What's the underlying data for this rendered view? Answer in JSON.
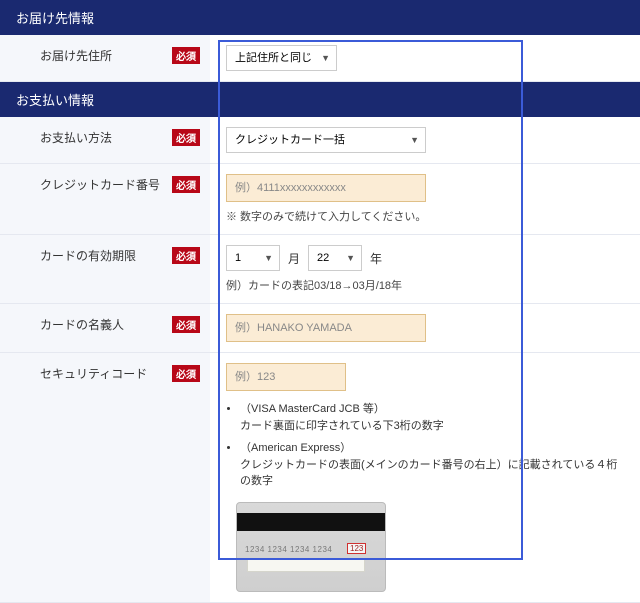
{
  "delivery": {
    "header": "お届け先情報",
    "address_label": "お届け先住所",
    "required": "必須",
    "address_select": "上記住所と同じ"
  },
  "payment": {
    "header": "お支払い情報",
    "method_label": "お支払い方法",
    "method_select": "クレジットカード一括",
    "cc_number_label": "クレジットカード番号",
    "cc_number_placeholder": "例）4111xxxxxxxxxxxx",
    "cc_number_hint": "※ 数字のみで続けて入力してください。",
    "expiry_label": "カードの有効期限",
    "expiry_month": "1",
    "expiry_month_suffix": "月",
    "expiry_year": "22",
    "expiry_year_suffix": "年",
    "expiry_hint": "例）カードの表記03/18→03月/18年",
    "holder_label": "カードの名義人",
    "holder_placeholder": "例）HANAKO YAMADA",
    "cvv_label": "セキュリティコード",
    "cvv_placeholder": "例）123",
    "cvv_note1_head": "（VISA MasterCard JCB 等）",
    "cvv_note1_body": "カード裏面に印字されている下3桁の数字",
    "cvv_note2_head": "（American Express）",
    "cvv_note2_body": "クレジットカードの表面(メインのカード番号の右上）に記載されている４桁の数字",
    "card_illus_digits": "1234  1234  1234  1234",
    "card_illus_cvv": "123"
  }
}
